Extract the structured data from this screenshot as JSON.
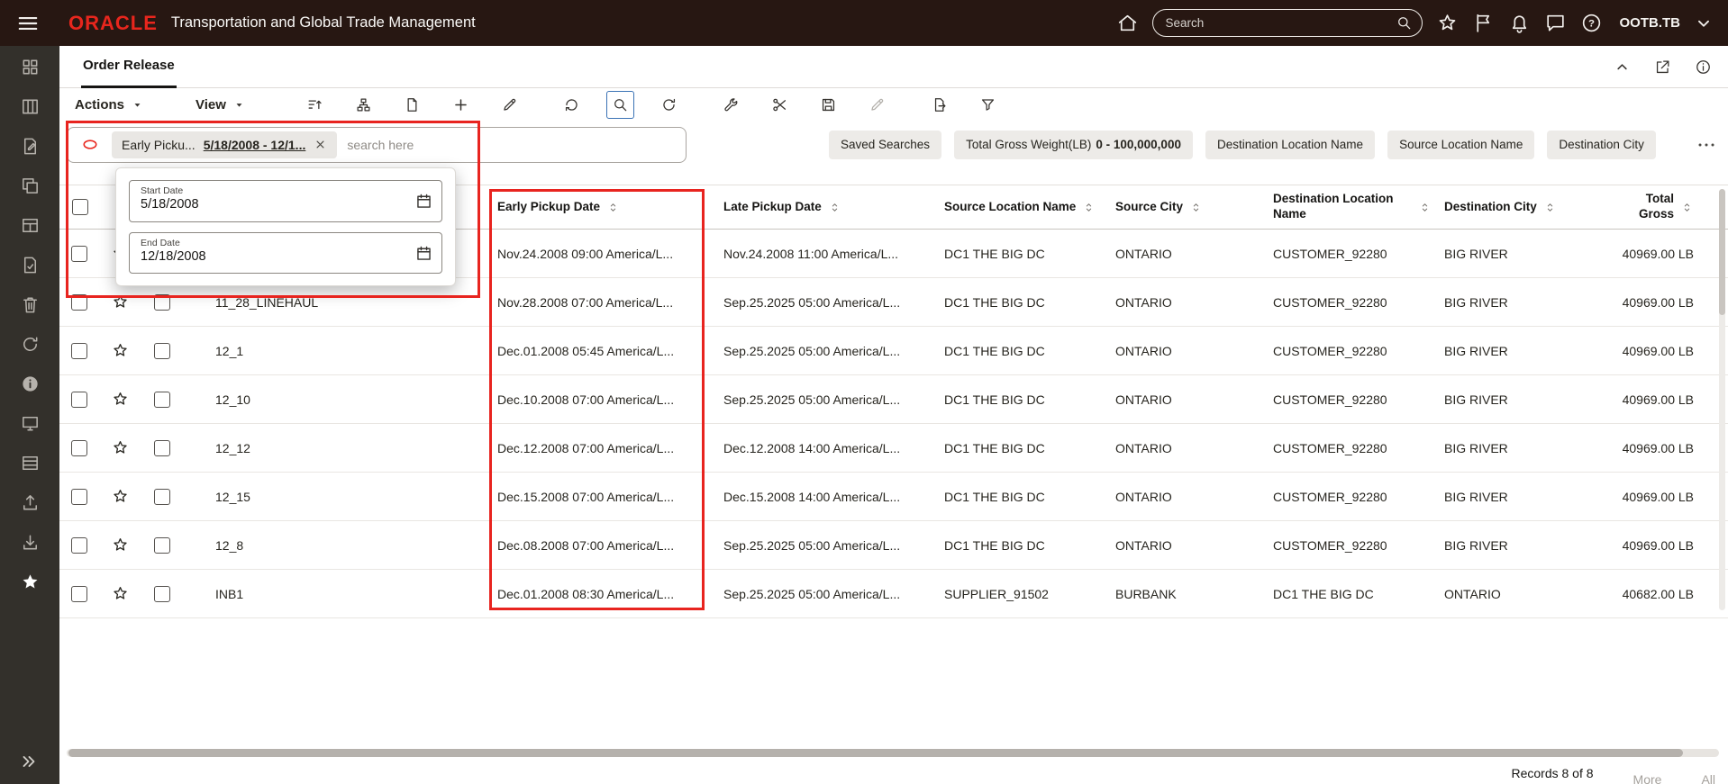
{
  "annotation_color": "#e8241f",
  "app_header": {
    "logo": "ORACLE",
    "title": "Transportation and Global Trade Management",
    "search_placeholder": "Search",
    "username": "OOTB.TB"
  },
  "sidebar": {
    "icons": [
      "apps-grid",
      "dashboard",
      "document-edit",
      "copy",
      "layout",
      "document-check",
      "trash",
      "refresh",
      "info-filled",
      "monitor",
      "data-rows",
      "upload",
      "download",
      "star-filled"
    ],
    "active_icon": "star-filled"
  },
  "tab_bar": {
    "active_tab": "Order Release"
  },
  "toolbar": {
    "actions_label": "Actions",
    "view_label": "View",
    "icons": [
      "sort",
      "hierarchy",
      "new-document",
      "add",
      "edit",
      "reload",
      "search",
      "refresh",
      "tools",
      "cut",
      "save",
      "edit-alt",
      "export",
      "filter"
    ],
    "active_icon": "search",
    "disabled_icon": "edit-alt"
  },
  "filter_bar": {
    "applied_filter": {
      "field": "Early Picku...",
      "range": "5/18/2008 - 12/1..."
    },
    "search_placeholder": "search here",
    "saved_searches_label": "Saved Searches",
    "filter_chips": [
      {
        "label": "Total Gross Weight(LB)",
        "value": "0 - 100,000,000"
      },
      {
        "label": "Destination Location Name"
      },
      {
        "label": "Source Location Name"
      },
      {
        "label": "Destination City"
      }
    ]
  },
  "date_popup": {
    "start": {
      "label": "Start Date",
      "value": "5/18/2008"
    },
    "end": {
      "label": "End Date",
      "value": "12/18/2008"
    }
  },
  "table": {
    "columns": [
      {
        "key": "sel",
        "label": "",
        "type": "checkbox"
      },
      {
        "key": "fav",
        "label": "",
        "type": "star"
      },
      {
        "key": "flag",
        "label": "",
        "type": "checkbox"
      },
      {
        "key": "id",
        "label": "",
        "type": "text"
      },
      {
        "key": "early",
        "label": "Early Pickup Date",
        "sortable": true
      },
      {
        "key": "late",
        "label": "Late Pickup Date",
        "sortable": true
      },
      {
        "key": "srcloc",
        "label": "Source Location Name",
        "sortable": true
      },
      {
        "key": "srccity",
        "label": "Source City",
        "sortable": true
      },
      {
        "key": "destloc",
        "label": "Destination Location Name",
        "sortable": true
      },
      {
        "key": "destcity",
        "label": "Destination City",
        "sortable": true
      },
      {
        "key": "total",
        "label": "Total Gross",
        "sortable": true
      }
    ],
    "rows": [
      {
        "id": "",
        "early": "Nov.24.2008 09:00 America/L...",
        "late": "Nov.24.2008 11:00 America/L...",
        "srcloc": "DC1 THE BIG DC",
        "srccity": "ONTARIO",
        "destloc": "CUSTOMER_92280",
        "destcity": "BIG RIVER",
        "total": "40969.00 LB"
      },
      {
        "id": "11_28_LINEHAUL",
        "early": "Nov.28.2008 07:00 America/L...",
        "late": "Sep.25.2025 05:00 America/L...",
        "srcloc": "DC1 THE BIG DC",
        "srccity": "ONTARIO",
        "destloc": "CUSTOMER_92280",
        "destcity": "BIG RIVER",
        "total": "40969.00 LB"
      },
      {
        "id": "12_1",
        "early": "Dec.01.2008 05:45 America/L...",
        "late": "Sep.25.2025 05:00 America/L...",
        "srcloc": "DC1 THE BIG DC",
        "srccity": "ONTARIO",
        "destloc": "CUSTOMER_92280",
        "destcity": "BIG RIVER",
        "total": "40969.00 LB"
      },
      {
        "id": "12_10",
        "early": "Dec.10.2008 07:00 America/L...",
        "late": "Sep.25.2025 05:00 America/L...",
        "srcloc": "DC1 THE BIG DC",
        "srccity": "ONTARIO",
        "destloc": "CUSTOMER_92280",
        "destcity": "BIG RIVER",
        "total": "40969.00 LB"
      },
      {
        "id": "12_12",
        "early": "Dec.12.2008 07:00 America/L...",
        "late": "Dec.12.2008 14:00 America/L...",
        "srcloc": "DC1 THE BIG DC",
        "srccity": "ONTARIO",
        "destloc": "CUSTOMER_92280",
        "destcity": "BIG RIVER",
        "total": "40969.00 LB"
      },
      {
        "id": "12_15",
        "early": "Dec.15.2008 07:00 America/L...",
        "late": "Dec.15.2008 14:00 America/L...",
        "srcloc": "DC1 THE BIG DC",
        "srccity": "ONTARIO",
        "destloc": "CUSTOMER_92280",
        "destcity": "BIG RIVER",
        "total": "40969.00 LB"
      },
      {
        "id": "12_8",
        "early": "Dec.08.2008 07:00 America/L...",
        "late": "Sep.25.2025 05:00 America/L...",
        "srcloc": "DC1 THE BIG DC",
        "srccity": "ONTARIO",
        "destloc": "CUSTOMER_92280",
        "destcity": "BIG RIVER",
        "total": "40969.00 LB"
      },
      {
        "id": "INB1",
        "early": "Dec.01.2008 08:30 America/L...",
        "late": "Sep.25.2025 05:00 America/L...",
        "srcloc": "SUPPLIER_91502",
        "srccity": "BURBANK",
        "destloc": "DC1 THE BIG DC",
        "destcity": "ONTARIO",
        "total": "40682.00 LB"
      }
    ]
  },
  "footer": {
    "records": "Records 8 of 8",
    "more_label": "More",
    "all_label": "All"
  }
}
